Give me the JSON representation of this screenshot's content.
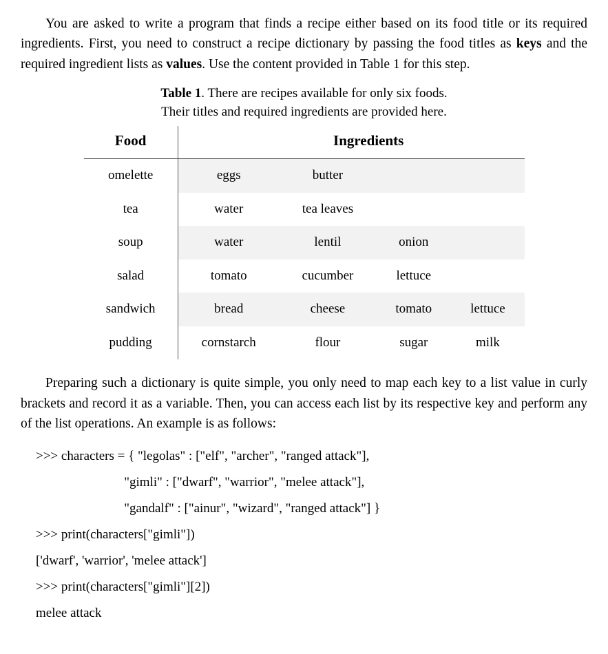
{
  "para1_parts": [
    "You are asked to write a program that finds a recipe either based on its food title or its required ingredients. First, you need to construct a recipe dictionary by passing the food titles as ",
    "keys",
    " and the required ingredient lists as ",
    "values",
    ". Use the content provided in Table 1 for this step."
  ],
  "table": {
    "caption_bold": "Table 1",
    "caption_rest": ". There are recipes available for only six foods.",
    "caption_line2": "Their titles and required ingredients are provided here.",
    "head_food": "Food",
    "head_ing": "Ingredients",
    "rows": [
      {
        "food": "omelette",
        "ings": [
          "eggs",
          "butter",
          "",
          ""
        ]
      },
      {
        "food": "tea",
        "ings": [
          "water",
          "tea leaves",
          "",
          ""
        ]
      },
      {
        "food": "soup",
        "ings": [
          "water",
          "lentil",
          "onion",
          ""
        ]
      },
      {
        "food": "salad",
        "ings": [
          "tomato",
          "cucumber",
          "lettuce",
          ""
        ]
      },
      {
        "food": "sandwich",
        "ings": [
          "bread",
          "cheese",
          "tomato",
          "lettuce"
        ]
      },
      {
        "food": "pudding",
        "ings": [
          "cornstarch",
          "flour",
          "sugar",
          "milk"
        ]
      }
    ]
  },
  "para2": "Preparing such a dictionary is quite simple, you only need to map each key to a list value in curly brackets and record it as a variable. Then, you can access each list by its respective key and perform any of the list operations. An example is as follows:",
  "code": {
    "l1": ">>> characters = { \"legolas\" : [\"elf\", \"archer\", \"ranged attack\"],",
    "l2": "                           \"gimli\" : [\"dwarf\", \"warrior\", \"melee attack\"],",
    "l3": "                           \"gandalf\" : [\"ainur\", \"wizard\", \"ranged attack\"] }",
    "l4": ">>> print(characters[\"gimli\"])",
    "l5": "['dwarf', 'warrior', 'melee attack']",
    "l6": ">>> print(characters[\"gimli\"][2])",
    "l7": "melee attack"
  }
}
